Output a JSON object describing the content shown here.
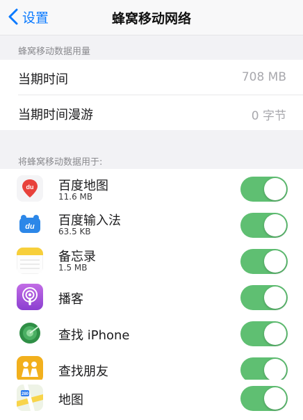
{
  "nav": {
    "back_label": "设置",
    "title": "蜂窝移动网络"
  },
  "usage": {
    "header": "蜂窝移动数据用量",
    "rows": [
      {
        "label": "当期时间",
        "value": "708 MB"
      },
      {
        "label": "当期时间漫游",
        "value": "0 字节"
      }
    ]
  },
  "apps": {
    "header": "将蜂窝移动数据用于:",
    "items": [
      {
        "name": "百度地图",
        "size": "11.6 MB",
        "icon": "baidu-map-icon",
        "enabled": true
      },
      {
        "name": "百度输入法",
        "size": "63.5 KB",
        "icon": "baidu-input-icon",
        "enabled": true
      },
      {
        "name": "备忘录",
        "size": "1.5 MB",
        "icon": "notes-icon",
        "enabled": true
      },
      {
        "name": "播客",
        "size": "",
        "icon": "podcasts-icon",
        "enabled": true
      },
      {
        "name": "查找 iPhone",
        "size": "",
        "icon": "find-iphone-icon",
        "enabled": true
      },
      {
        "name": "查找朋友",
        "size": "",
        "icon": "find-friends-icon",
        "enabled": true
      },
      {
        "name": "地图",
        "size": "",
        "icon": "maps-icon",
        "enabled": true
      }
    ]
  },
  "colors": {
    "accent": "#0a7aff",
    "toggle_on": "#5fbf72"
  }
}
